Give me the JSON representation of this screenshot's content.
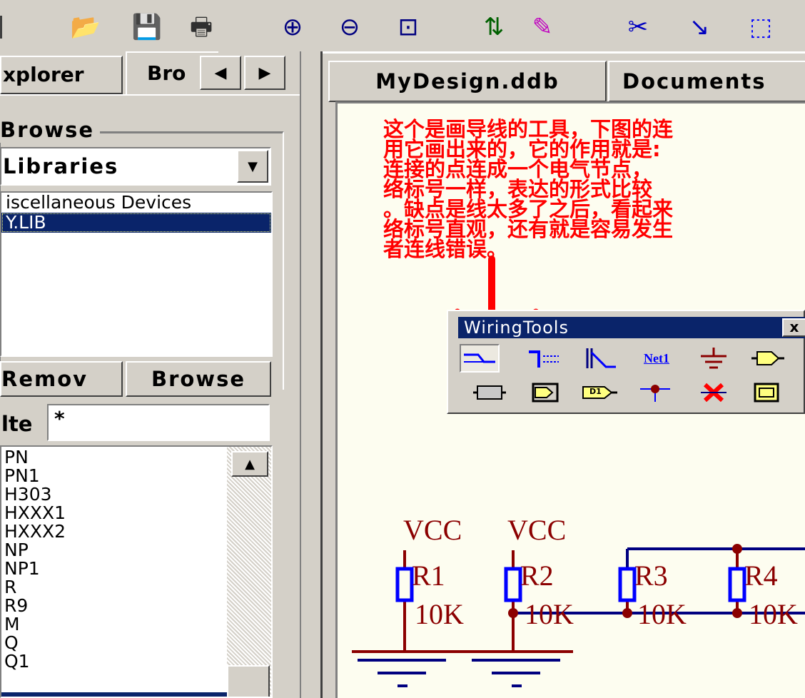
{
  "toolbar": {
    "items": [
      {
        "name": "open-folder-icon",
        "glyph": "📂"
      },
      {
        "name": "save-icon",
        "glyph": "💾"
      },
      {
        "name": "print-icon",
        "glyph": "🖶"
      },
      {
        "name": "zoom-in-icon",
        "glyph": "⊕"
      },
      {
        "name": "zoom-out-icon",
        "glyph": "⊖"
      },
      {
        "name": "zoom-fit-icon",
        "glyph": "⊡"
      },
      {
        "name": "sort-arrows-icon",
        "glyph": "⇅"
      },
      {
        "name": "magic-wand-icon",
        "glyph": "✎"
      },
      {
        "name": "cut-wire-icon",
        "glyph": "✂"
      },
      {
        "name": "probe-icon",
        "glyph": "↘"
      },
      {
        "name": "select-area-icon",
        "glyph": "⬚"
      }
    ]
  },
  "left_panel": {
    "tabs": [
      "xplorer",
      "Bro"
    ],
    "group_title": "Browse",
    "browse_select": "Libraries",
    "libraries": [
      "iscellaneous Devices",
      "Y.LIB"
    ],
    "selected_library_index": 1,
    "remove_button": "Remov",
    "browse_button": "Browse",
    "filter_label": "lte",
    "filter_value": "*",
    "components": [
      "PN",
      "PN1",
      "H303",
      "HXXX1",
      "HXXX2",
      "NP",
      "NP1",
      "R",
      "R9",
      "M",
      "Q",
      "Q1"
    ]
  },
  "document_tabs": [
    "MyDesign.ddb",
    "Documents"
  ],
  "annotation_text": [
    "这个是画导线的工具，下图的连",
    "用它画出来的，它的作用就是:",
    "连接的点连成一个电气节点，",
    "络标号一样，表达的形式比较",
    "。缺点是线太多了之后，看起来",
    "络标号直观，还有就是容易发生",
    "者连线错误。"
  ],
  "wiring_tools": {
    "title": "WiringTools",
    "close_label": "x",
    "row1": [
      "wire-tool",
      "bus-tool",
      "bus-entry-tool",
      "net-label-tool",
      "ground-tool",
      "port-tool"
    ],
    "row2": [
      "sheet-symbol-tool",
      "sheet-entry-tool",
      "part-tool",
      "junction-tool",
      "no-erc-tool",
      "directive-tool"
    ],
    "net_label_text": "Net1",
    "part_label_text": "D1"
  },
  "schematic": {
    "vcc_labels": [
      "VCC",
      "VCC"
    ],
    "resistors": [
      {
        "ref": "R1",
        "value": "10K"
      },
      {
        "ref": "R2",
        "value": "10K"
      },
      {
        "ref": "R3",
        "value": "10K"
      },
      {
        "ref": "R4",
        "value": "10K"
      }
    ]
  },
  "colors": {
    "face": "#d4d0c8",
    "title_bar": "#0a246a",
    "selection": "#0a246a",
    "note_red": "#ff0000",
    "wire_blue": "#000080",
    "component_blue": "#0000ff",
    "label_darkred": "#8b0000",
    "sheet_bg": "#fdfdf0"
  }
}
